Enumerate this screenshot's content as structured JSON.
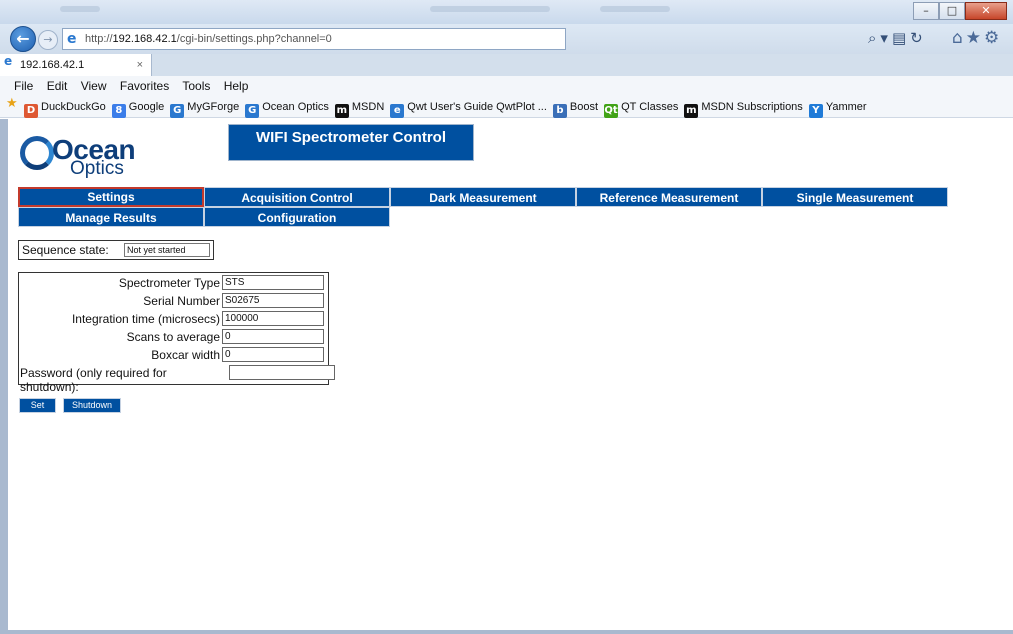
{
  "browser": {
    "window_controls": [
      "–",
      "□",
      "✕"
    ],
    "address_prefix": "http://",
    "address_host": "192.168.42.1",
    "address_path": "/cgi-bin/settings.php?channel=0",
    "tab_title": "192.168.42.1",
    "tab_close": "×",
    "menu": [
      "File",
      "Edit",
      "View",
      "Favorites",
      "Tools",
      "Help"
    ],
    "favorites": [
      {
        "label": "DuckDuckGo",
        "icon": "duckduckgo-icon",
        "color": "#de5833",
        "glyph": "D"
      },
      {
        "label": "Google",
        "icon": "google-icon",
        "color": "#3b7de9",
        "glyph": "8"
      },
      {
        "label": "MyGForge",
        "icon": "gforge-icon",
        "color": "#2a78cf",
        "glyph": "G"
      },
      {
        "label": "Ocean Optics",
        "icon": "gforge-icon",
        "color": "#2a78cf",
        "glyph": "G"
      },
      {
        "label": "MSDN",
        "icon": "msdn-icon",
        "color": "#111111",
        "glyph": "m"
      },
      {
        "label": "Qwt User's Guide QwtPlot ...",
        "icon": "ie-page-icon",
        "color": "#2a78cf",
        "glyph": "e"
      },
      {
        "label": "Boost",
        "icon": "boost-icon",
        "color": "#3a6fb8",
        "glyph": "b"
      },
      {
        "label": "QT Classes",
        "icon": "qt-icon",
        "color": "#41a317",
        "glyph": "Qt"
      },
      {
        "label": "MSDN Subscriptions",
        "icon": "msdn-icon",
        "color": "#111111",
        "glyph": "m"
      },
      {
        "label": "Yammer",
        "icon": "yammer-icon",
        "color": "#1f7bd8",
        "glyph": "Y"
      }
    ]
  },
  "page": {
    "logo_word1": "Ocean",
    "logo_word2": "Optics",
    "title": "WIFI Spectrometer Control",
    "nav": [
      {
        "label": "Settings",
        "active": true
      },
      {
        "label": "Acquisition Control",
        "active": false
      },
      {
        "label": "Dark Measurement",
        "active": false
      },
      {
        "label": "Reference Measurement",
        "active": false
      },
      {
        "label": "Single Measurement",
        "active": false
      },
      {
        "label": "Manage Results",
        "active": false
      },
      {
        "label": "Configuration",
        "active": false
      }
    ],
    "sequence_label": "Sequence state:",
    "sequence_value": "Not yet started",
    "form": [
      {
        "label": "Spectrometer Type",
        "value": "STS"
      },
      {
        "label": "Serial Number",
        "value": "S02675"
      },
      {
        "label": "Integration time (microsecs)",
        "value": "100000"
      },
      {
        "label": "Scans to average",
        "value": "0"
      },
      {
        "label": "Boxcar width",
        "value": "0"
      },
      {
        "label": "Password (only required for shutdown):",
        "value": ""
      }
    ],
    "set_label": "Set",
    "shutdown_label": "Shutdown"
  },
  "colors": {
    "nav_blue": "#0050a0",
    "active_border": "#c33a2c"
  }
}
